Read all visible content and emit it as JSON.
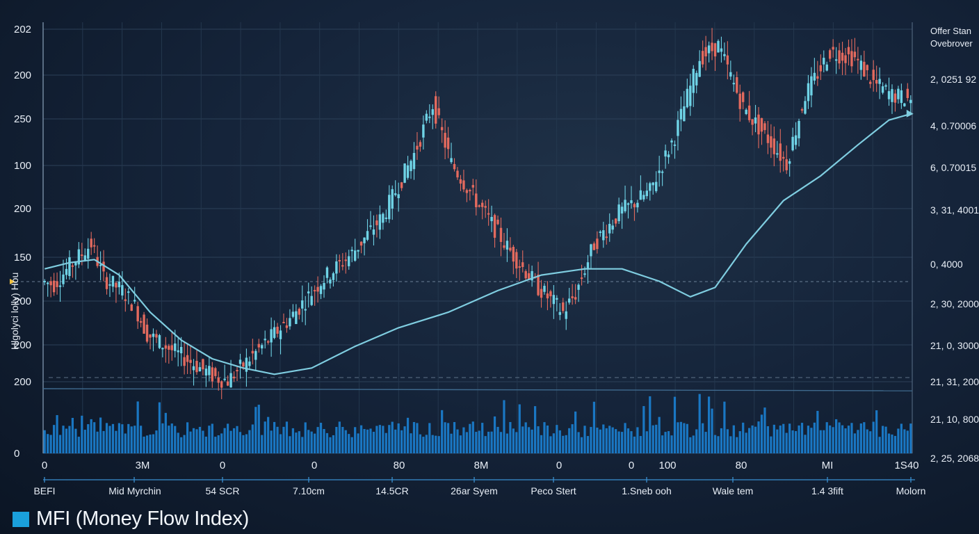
{
  "legend": {
    "label": "MFI (Money Flow Index)",
    "swatch_color": "#1aa0dc"
  },
  "side_label": "Hlgolyci lolly) Hou",
  "legend_right": [
    "Offer Stan",
    "Ovebrover"
  ],
  "colors": {
    "up": "#6fd3e6",
    "down": "#e36a5e",
    "ma": "#7fcde0",
    "volume": "#1b7fcf"
  },
  "chart_data": {
    "type": "candlestick",
    "y_tick_labels": [
      "202",
      "200",
      "250",
      "100",
      "200",
      "150",
      "200",
      "200",
      "200",
      "0"
    ],
    "right_tick_labels": [
      "2, 0251 92",
      "4, 0.70006",
      "6, 0.70015",
      "3, 31, 4001",
      "0, 4000",
      "2, 30, 2000",
      "21, 0, 3000",
      "21, 31, 2000",
      "21, 10, 8000",
      "2, 25, 2068"
    ],
    "x_tick_labels": [
      "0",
      "3M",
      "0",
      "0",
      "80",
      "8M",
      "0",
      "0",
      "100",
      "80",
      "MI",
      "1S40"
    ],
    "x_category_labels": [
      "BEFI",
      "Mid Myrchin",
      "54 SCR",
      "7.10cm",
      "14.5CR",
      "26ar Syem",
      "Peco Stert",
      "1.Sneb ooh",
      "Wale tem",
      "1.4 3fift",
      "Molorn"
    ],
    "series": {
      "price_anchors": [
        [
          0,
          36
        ],
        [
          4,
          35
        ],
        [
          10,
          42
        ],
        [
          16,
          48
        ],
        [
          20,
          37
        ],
        [
          26,
          33
        ],
        [
          30,
          28
        ],
        [
          34,
          19
        ],
        [
          40,
          15
        ],
        [
          48,
          10
        ],
        [
          56,
          5
        ],
        [
          60,
          4
        ],
        [
          70,
          14
        ],
        [
          80,
          24
        ],
        [
          90,
          36
        ],
        [
          100,
          45
        ],
        [
          110,
          57
        ],
        [
          120,
          77
        ],
        [
          126,
          93
        ],
        [
          132,
          74
        ],
        [
          140,
          62
        ],
        [
          150,
          47
        ],
        [
          160,
          34
        ],
        [
          168,
          26
        ],
        [
          172,
          32
        ],
        [
          178,
          48
        ],
        [
          186,
          58
        ],
        [
          196,
          65
        ],
        [
          204,
          83
        ],
        [
          212,
          108
        ],
        [
          218,
          112
        ],
        [
          226,
          92
        ],
        [
          234,
          82
        ],
        [
          240,
          74
        ],
        [
          246,
          96
        ],
        [
          254,
          110
        ],
        [
          262,
          108
        ],
        [
          268,
          100
        ],
        [
          274,
          96
        ],
        [
          279,
          95
        ]
      ],
      "moving_average": [
        [
          0,
          40
        ],
        [
          8,
          42
        ],
        [
          16,
          43
        ],
        [
          24,
          38
        ],
        [
          34,
          26
        ],
        [
          44,
          17
        ],
        [
          54,
          11
        ],
        [
          64,
          8
        ],
        [
          74,
          6
        ],
        [
          86,
          8
        ],
        [
          100,
          15
        ],
        [
          114,
          21
        ],
        [
          130,
          26
        ],
        [
          146,
          33
        ],
        [
          160,
          38
        ],
        [
          174,
          40
        ],
        [
          186,
          40
        ],
        [
          198,
          36
        ],
        [
          208,
          31
        ],
        [
          216,
          34
        ],
        [
          226,
          48
        ],
        [
          238,
          62
        ],
        [
          250,
          70
        ],
        [
          262,
          80
        ],
        [
          272,
          88
        ],
        [
          279,
          90
        ]
      ],
      "volume_range": [
        0.25,
        0.95
      ]
    },
    "grid": true,
    "legend_position": "bottom-left"
  }
}
